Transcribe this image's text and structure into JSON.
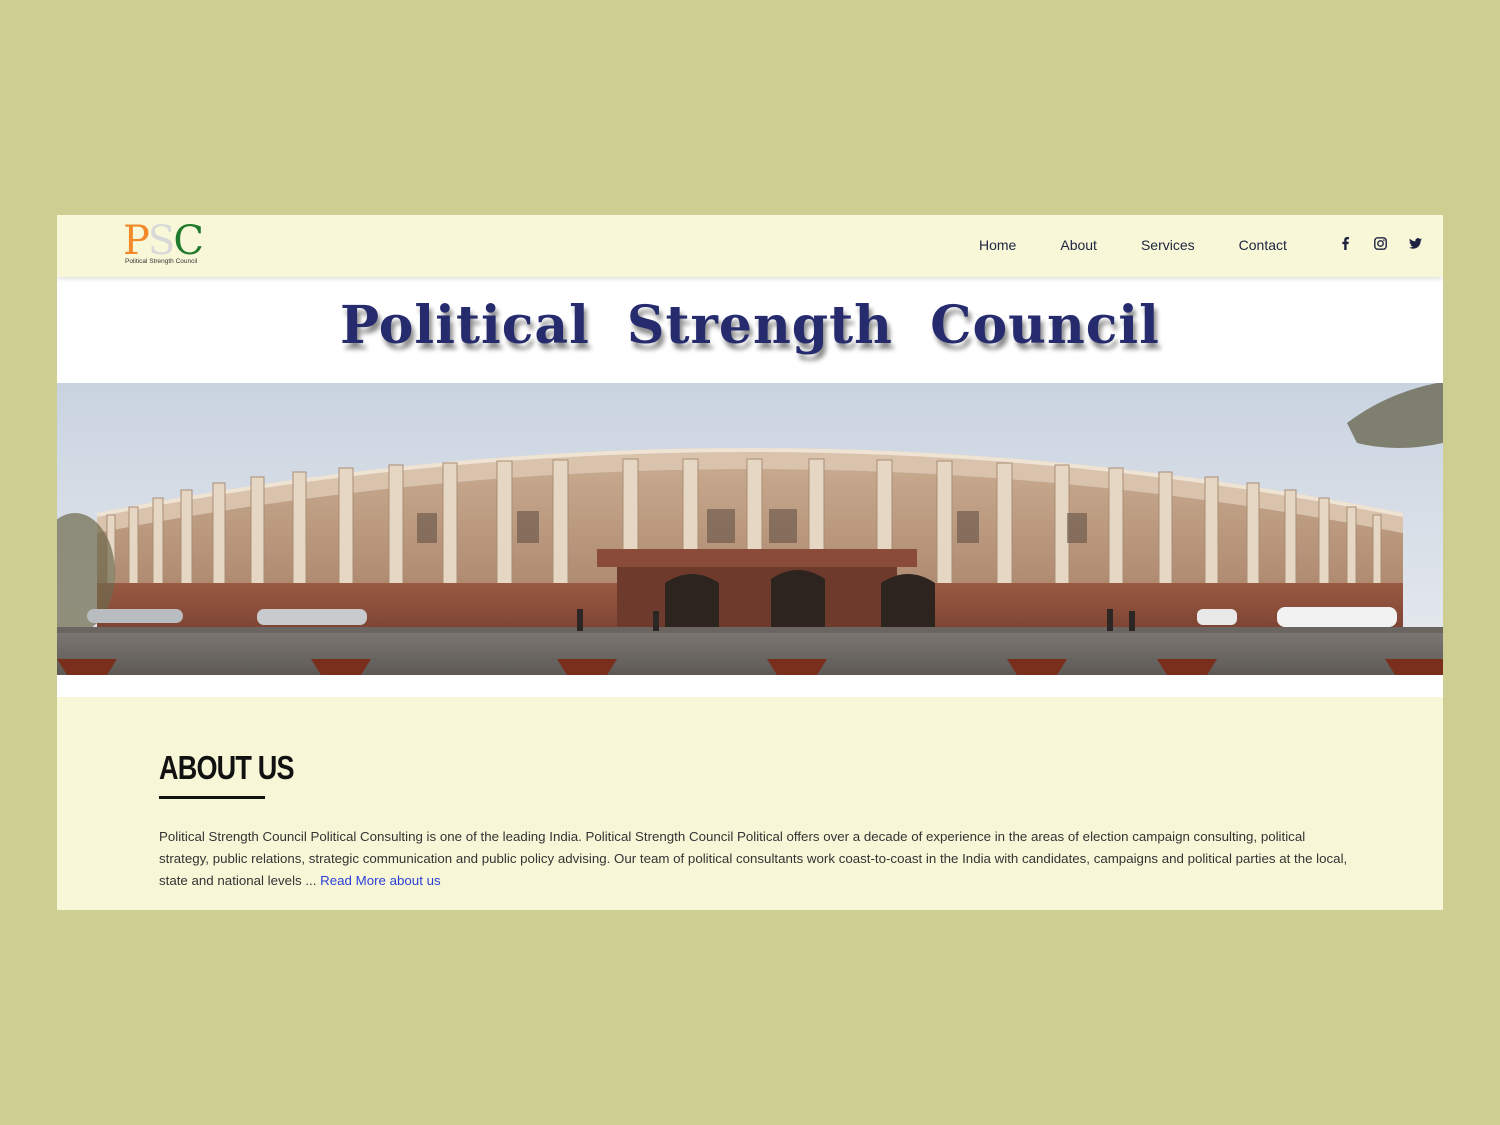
{
  "logo": {
    "letters": [
      "P",
      "S",
      "C"
    ],
    "tagline": "Political Strength Council"
  },
  "nav": {
    "home": "Home",
    "about": "About",
    "services": "Services",
    "contact": "Contact"
  },
  "social": [
    "facebook-icon",
    "instagram-icon",
    "twitter-icon"
  ],
  "site_title": "Political Strength Council",
  "hero": {
    "subject": "parliament-building-photo"
  },
  "about": {
    "heading": "ABOUT US",
    "body": "Political Strength Council Political Consulting is one of the leading India. Political Strength Council Political offers over a decade of experience in the areas of election campaign consulting, political strategy, public relations, strategic communication and public policy advising. Our team of political consultants work coast-to-coast in the India with candidates, campaigns and political parties at the local, state and national levels ... ",
    "read_more": "Read More about us"
  },
  "colors": {
    "page_bg": "#cfce92",
    "header_bg": "#f8f8d8",
    "title": "#262b6e",
    "link": "#2a3fd6"
  }
}
